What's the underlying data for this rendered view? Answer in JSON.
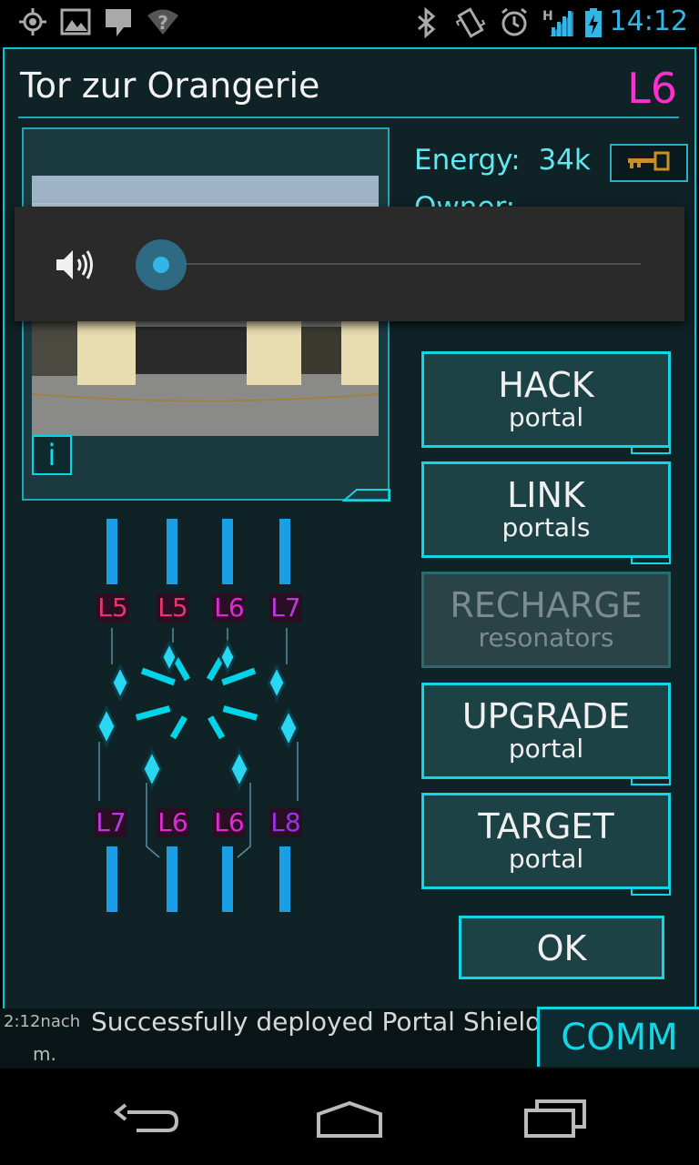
{
  "status_bar": {
    "time": "14:12",
    "icons": [
      "gps-icon",
      "gallery-icon",
      "chat-icon",
      "wifi-question-icon",
      "bluetooth-icon",
      "vibrate-icon",
      "alarm-icon",
      "signal-h-icon",
      "battery-charging-icon"
    ],
    "network_type": "H"
  },
  "portal": {
    "name": "Tor zur Orangerie",
    "level": "L6",
    "energy_label": "Energy:",
    "energy_value": "34k",
    "owner_label": "Owner:",
    "info_label": "i"
  },
  "volume": {
    "icon": "speaker-icon",
    "level": 0
  },
  "actions": [
    {
      "line1": "HACK",
      "line2": "portal",
      "enabled": true
    },
    {
      "line1": "LINK",
      "line2": "portals",
      "enabled": true
    },
    {
      "line1": "RECHARGE",
      "line2": "resonators",
      "enabled": false
    },
    {
      "line1": "UPGRADE",
      "line2": "portal",
      "enabled": true
    },
    {
      "line1": "TARGET",
      "line2": "portal",
      "enabled": true
    }
  ],
  "ok_label": "OK",
  "resonators": {
    "top": [
      "L5",
      "L5",
      "L6",
      "L7"
    ],
    "bottom": [
      "L7",
      "L6",
      "L6",
      "L8"
    ],
    "colors": {
      "L5": "#e8356a",
      "L6": "#dd2bd6",
      "L7": "#b83ae0",
      "L8": "#9a33e8"
    }
  },
  "comm": {
    "time_fragment": "2:12nach",
    "message_fragment": "Successfully deployed Portal Shield",
    "m_fragment": "m.",
    "button_label": "COMM"
  },
  "colors": {
    "accent": "#12d6e6",
    "panel_bg": "#0f2226",
    "level_pink": "#ff2ecf"
  },
  "nav": [
    "back-icon",
    "home-icon",
    "recent-apps-icon"
  ]
}
